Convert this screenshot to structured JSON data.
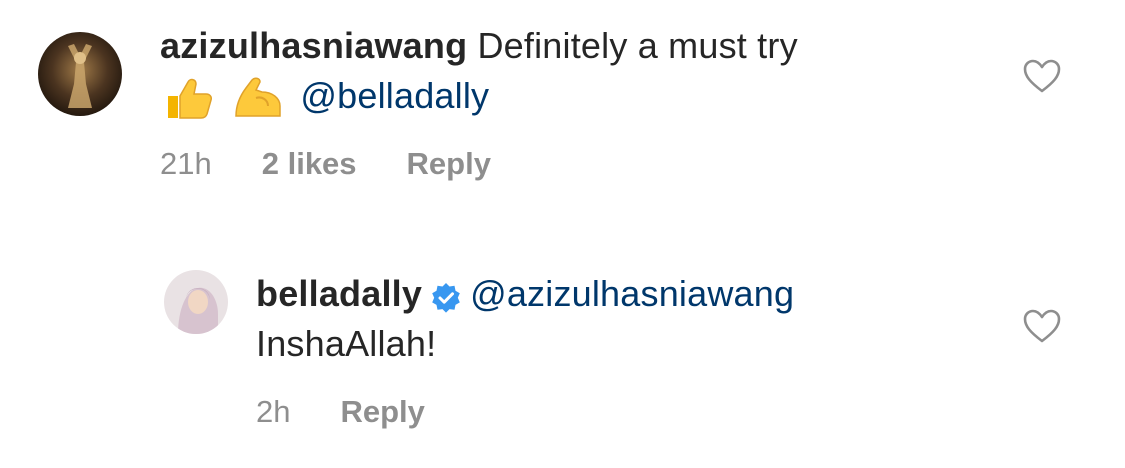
{
  "comments": [
    {
      "username": "azizulhasniawang",
      "text": "Definitely a must try",
      "emojis": [
        "thumbs-up-icon",
        "flexed-biceps-icon"
      ],
      "mention": "@belladally",
      "time": "21h",
      "likes": "2 likes",
      "reply": "Reply"
    }
  ],
  "replies": [
    {
      "username": "belladally",
      "verified": true,
      "mention": "@azizulhasniawang",
      "text": "InshaAllah!",
      "time": "2h",
      "reply": "Reply"
    }
  ],
  "colors": {
    "text": "#262626",
    "mention": "#00376b",
    "meta": "#8e8e8e",
    "verified": "#3897f0",
    "heart": "#8e8e8e"
  }
}
